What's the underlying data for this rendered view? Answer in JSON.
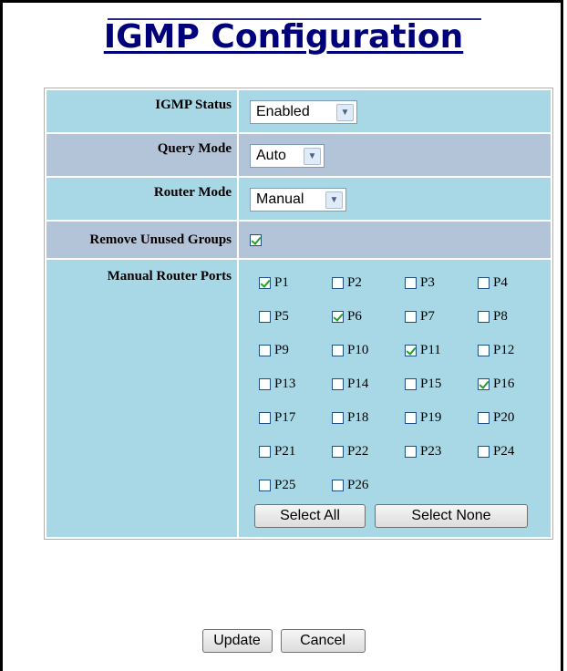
{
  "title": "IGMP Configuration",
  "rows": {
    "igmp_status": {
      "label": "IGMP Status",
      "value": "Enabled"
    },
    "query_mode": {
      "label": "Query Mode",
      "value": "Auto"
    },
    "router_mode": {
      "label": "Router Mode",
      "value": "Manual"
    },
    "remove_unused": {
      "label": "Remove Unused Groups",
      "checked": true
    },
    "manual_ports": {
      "label": "Manual Router Ports"
    }
  },
  "ports": [
    {
      "name": "P1",
      "checked": true
    },
    {
      "name": "P2",
      "checked": false
    },
    {
      "name": "P3",
      "checked": false
    },
    {
      "name": "P4",
      "checked": false
    },
    {
      "name": "P5",
      "checked": false
    },
    {
      "name": "P6",
      "checked": true
    },
    {
      "name": "P7",
      "checked": false
    },
    {
      "name": "P8",
      "checked": false
    },
    {
      "name": "P9",
      "checked": false
    },
    {
      "name": "P10",
      "checked": false
    },
    {
      "name": "P11",
      "checked": true
    },
    {
      "name": "P12",
      "checked": false
    },
    {
      "name": "P13",
      "checked": false
    },
    {
      "name": "P14",
      "checked": false
    },
    {
      "name": "P15",
      "checked": false
    },
    {
      "name": "P16",
      "checked": true
    },
    {
      "name": "P17",
      "checked": false
    },
    {
      "name": "P18",
      "checked": false
    },
    {
      "name": "P19",
      "checked": false
    },
    {
      "name": "P20",
      "checked": false
    },
    {
      "name": "P21",
      "checked": false
    },
    {
      "name": "P22",
      "checked": false
    },
    {
      "name": "P23",
      "checked": false
    },
    {
      "name": "P24",
      "checked": false
    },
    {
      "name": "P25",
      "checked": false
    },
    {
      "name": "P26",
      "checked": false
    }
  ],
  "buttons": {
    "select_all": "Select All",
    "select_none": "Select None",
    "update": "Update",
    "cancel": "Cancel"
  },
  "colors": {
    "title": "#00007a",
    "row_blue": "#a8d8e6",
    "row_gray": "#b4c4d8",
    "check": "#21a121"
  }
}
